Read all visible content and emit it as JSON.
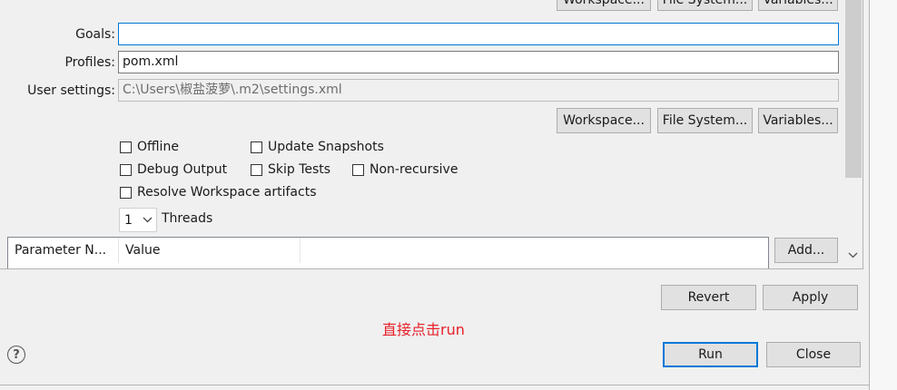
{
  "top_buttons": {
    "workspace": "Workspace...",
    "file_system": "File System...",
    "variables": "Variables..."
  },
  "form": {
    "goals_label": "Goals:",
    "goals_value": "",
    "profiles_label": "Profiles:",
    "profiles_value": "pom.xml",
    "user_settings_label": "User settings:",
    "user_settings_value": "C:\\Users\\椒盐菠萝\\.m2\\settings.xml"
  },
  "settings_buttons": {
    "workspace": "Workspace...",
    "file_system": "File System...",
    "variables": "Variables..."
  },
  "options": {
    "offline": "Offline",
    "update_snapshots": "Update Snapshots",
    "debug_output": "Debug Output",
    "skip_tests": "Skip Tests",
    "non_recursive": "Non-recursive",
    "resolve_workspace": "Resolve Workspace artifacts",
    "threads_value": "1",
    "threads_label": "Threads"
  },
  "param_table": {
    "columns": [
      "Parameter N...",
      "Value"
    ],
    "add_button": "Add..."
  },
  "actions": {
    "revert": "Revert",
    "apply": "Apply",
    "run": "Run",
    "close": "Close"
  },
  "annotation": "直接点击run",
  "colors": {
    "annotation": "#e8202a",
    "focus": "#0078d7"
  }
}
